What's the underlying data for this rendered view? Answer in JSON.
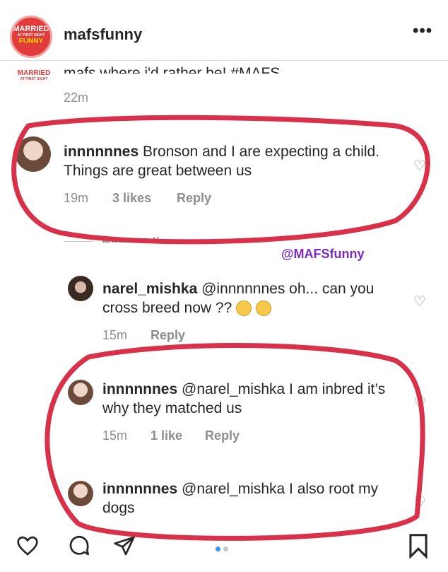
{
  "header": {
    "username": "mafsfunny",
    "logo_text": [
      "MARRIED",
      "AT FIRST SIGHT",
      "FUNNY"
    ],
    "more_label": "•••"
  },
  "caption": {
    "logo_text": [
      "MARRIED",
      "AT FIRST SIGHT"
    ],
    "text": "mafs where i'd rather be! #MAFS",
    "time": "22m"
  },
  "comment1": {
    "username": "innnnnnes",
    "text": "Bronson and I are expecting a child. Things are great between us",
    "time": "19m",
    "likes": "3 likes",
    "reply": "Reply"
  },
  "hide_replies": "Hide replies",
  "watermark": "@MAFSfunny",
  "reply1": {
    "username": "narel_mishka",
    "text": "@innnnnnes oh... can you cross breed now ??",
    "time": "15m",
    "reply": "Reply"
  },
  "reply2": {
    "username": "innnnnnes",
    "text": "@narel_mishka I am inbred it’s why they matched us",
    "time": "15m",
    "likes": "1 like",
    "reply": "Reply"
  },
  "reply3": {
    "username": "innnnnnes",
    "text": "@narel_mishka I also root my dogs"
  },
  "colors": {
    "accent_red": "#d9314a",
    "watermark_purple": "#7a2cc2",
    "meta_gray": "#8e8e8e",
    "carousel_active": "#3897f0"
  },
  "footer": {
    "icons": [
      "heart-icon",
      "comment-icon",
      "share-icon",
      "bookmark-icon"
    ]
  }
}
